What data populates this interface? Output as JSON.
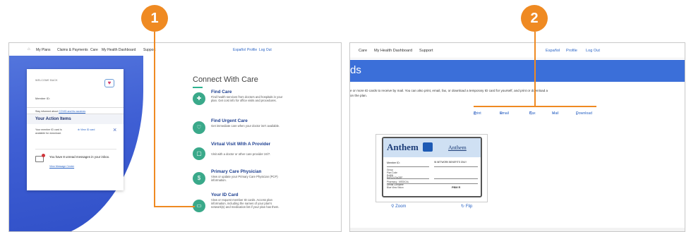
{
  "steps": {
    "one": "1",
    "two": "2"
  },
  "left": {
    "nav": {
      "home_icon": "home-icon",
      "items": [
        "My Plans",
        "Claims & Payments",
        "Care",
        "My Health Dashboard",
        "Support"
      ],
      "utility": [
        "Español",
        "Profile",
        "Log Out"
      ]
    },
    "welcome": {
      "greeting": "WELCOME BACK",
      "member_id_label": "Member ID:",
      "covid_prefix": "Stay informed about",
      "covid_link": "COVID and its vaccines",
      "actions_title": "Your Action Items",
      "id_card_text": "Your member ID card is available for download.",
      "view_id_card": "View ID card",
      "close_glyph": "×",
      "messages_text": "You have 8 unread messages in your inbox.",
      "message_center_link": "View Message Center"
    },
    "connect": {
      "title": "Connect With Care",
      "items": [
        {
          "title": "Find Care",
          "desc": "Find health services from doctors and hospitals in your plan. Get cost info for office visits and procedures.",
          "icon": "hospital-icon"
        },
        {
          "title": "Find Urgent Care",
          "desc": "Get immediate care when your doctor isn't available.",
          "icon": "heartbeat-icon"
        },
        {
          "title": "Virtual Visit With A Provider",
          "desc": "Visit with a doctor or other care provider 24/7.",
          "icon": "chat-icon"
        },
        {
          "title": "Primary Care Physician",
          "desc": "View or update your Primary Care Physician (PCP) information.",
          "icon": "dollar-icon"
        },
        {
          "title": "Your ID Card",
          "desc": "View or request member ID cards. Access plan information, including the names of your plan's network(s) and medication list if your plan has them.",
          "icon": "id-card-icon"
        }
      ]
    }
  },
  "right": {
    "nav": {
      "items": [
        "Care",
        "My Health Dashboard",
        "Support"
      ],
      "utility": [
        "Español",
        "Profile",
        "Log Out"
      ]
    },
    "banner_title": "ds",
    "description_line1": "e or more ID cards to receive by mail. You can also print, email, fax, or download a temporary ID card for yourself, and print or download a",
    "description_line2": "on the plan.",
    "actions": {
      "print": "Print",
      "email": "Email",
      "fax": "Fax",
      "mail": "Mail",
      "download": "Download"
    },
    "card": {
      "brand": "Anthem",
      "brand_secondary": "Anthem",
      "member_id_label": "Member ID:",
      "in_network": "IN NETWORK BENEFITS ONLY",
      "fields": [
        "Group",
        "Plan Code",
        "RxBIN",
        "RxPCN   RxGRP",
        "Pharmacy  - MEDICAL",
        "Dental Complete",
        "Blue View Vision"
      ],
      "pbm": "PBM  R"
    },
    "zoom": "Zoom",
    "flip": "Flip"
  },
  "colors": {
    "accent_orange": "#ef8a22",
    "link_blue": "#2a64c5",
    "banner_blue": "#3b6fd9",
    "care_green": "#3aa98a"
  }
}
